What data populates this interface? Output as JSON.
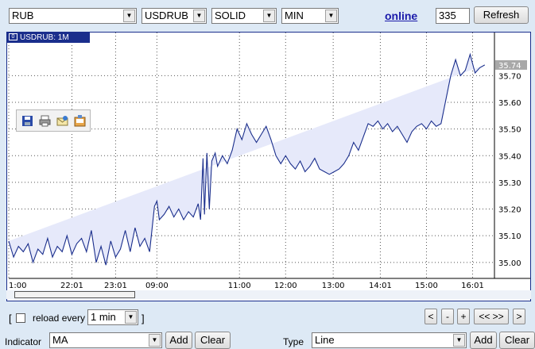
{
  "toolbar": {
    "currency": "RUB",
    "symbol": "USDRUB",
    "style": "SOLID",
    "period": "MIN",
    "online_label": "online",
    "count_value": "335",
    "refresh_label": "Refresh"
  },
  "chart_tab": {
    "label": "USDRUB: 1M",
    "box_glyph": "0"
  },
  "reload": {
    "open_bracket": "[",
    "label": "reload every",
    "interval": "1 min",
    "close_bracket": "]"
  },
  "nav": {
    "prev": "<",
    "zoom_out": "-",
    "zoom_in": "+",
    "reset": "<< >>",
    "next": ">"
  },
  "bottom": {
    "indicator_label": "Indicator",
    "indicator_value": "MA",
    "indicator_add": "Add",
    "indicator_clear": "Clear",
    "type_label": "Type",
    "type_value": "Line",
    "type_add": "Add",
    "type_clear": "Clear"
  },
  "colors": {
    "line": "#1a2e8c",
    "fill": "#e6e9fa",
    "tag_bg": "#a8a8a8",
    "tab_bg": "#1a2e8c"
  },
  "chart_data": {
    "type": "area",
    "series": [
      {
        "name": "USDRUB: 1M"
      }
    ],
    "ylim": [
      34.94,
      35.82
    ],
    "yticks": [
      "35.00",
      "35.10",
      "35.20",
      "35.30",
      "35.40",
      "35.50",
      "35.60",
      "35.70"
    ],
    "xticks": [
      "1:00",
      "22:01",
      "23:01",
      "09:00",
      "11:00",
      "12:00",
      "13:00",
      "14:01",
      "15:00",
      "16:01"
    ],
    "xlim": [
      0,
      100
    ],
    "xtick_pos": [
      0,
      13,
      22,
      30.5,
      47.5,
      57,
      66.8,
      76.5,
      86,
      95.5
    ],
    "last_value": "35.74",
    "x": [
      0,
      1,
      2,
      3,
      4,
      5,
      6,
      7,
      8,
      9,
      10,
      11,
      12,
      13,
      14,
      15,
      16,
      17,
      18,
      19,
      20,
      21,
      22,
      23,
      24,
      25,
      26,
      27,
      28,
      29,
      30,
      30.5,
      31,
      32,
      33,
      34,
      35,
      36,
      37,
      38,
      39,
      39.5,
      40,
      40.3,
      40.8,
      41.3,
      41.8,
      42.5,
      43,
      44,
      45,
      46,
      47,
      48,
      49,
      50,
      51,
      52,
      53,
      54,
      55,
      56,
      57,
      58,
      59,
      60,
      61,
      62,
      63,
      64,
      65,
      66,
      67,
      68,
      69,
      70,
      71,
      72,
      73,
      74,
      75,
      76,
      77,
      78,
      79,
      80,
      81,
      82,
      83,
      84,
      85,
      86,
      87,
      88,
      89,
      90,
      91,
      92,
      93,
      94,
      95,
      96,
      97,
      98,
      99,
      100
    ],
    "y": [
      35.08,
      35.02,
      35.06,
      35.04,
      35.07,
      35.0,
      35.05,
      35.03,
      35.09,
      35.02,
      35.06,
      35.04,
      35.1,
      35.03,
      35.07,
      35.09,
      35.04,
      35.12,
      35.0,
      35.06,
      34.99,
      35.08,
      35.02,
      35.05,
      35.12,
      35.04,
      35.13,
      35.06,
      35.09,
      35.04,
      35.21,
      35.23,
      35.16,
      35.18,
      35.21,
      35.17,
      35.2,
      35.16,
      35.19,
      35.17,
      35.22,
      35.16,
      35.39,
      35.18,
      35.41,
      35.2,
      35.38,
      35.41,
      35.36,
      35.4,
      35.37,
      35.42,
      35.5,
      35.46,
      35.52,
      35.48,
      35.45,
      35.48,
      35.51,
      35.46,
      35.4,
      35.37,
      35.4,
      35.37,
      35.35,
      35.38,
      35.34,
      35.36,
      35.39,
      35.35,
      35.34,
      35.33,
      35.34,
      35.35,
      35.37,
      35.4,
      35.45,
      35.42,
      35.47,
      35.52,
      35.51,
      35.53,
      35.5,
      35.52,
      35.49,
      35.51,
      35.48,
      35.45,
      35.49,
      35.51,
      35.52,
      35.5,
      35.53,
      35.51,
      35.52,
      35.61,
      35.7,
      35.76,
      35.7,
      35.72,
      35.78,
      35.71,
      35.73,
      35.74
    ]
  }
}
